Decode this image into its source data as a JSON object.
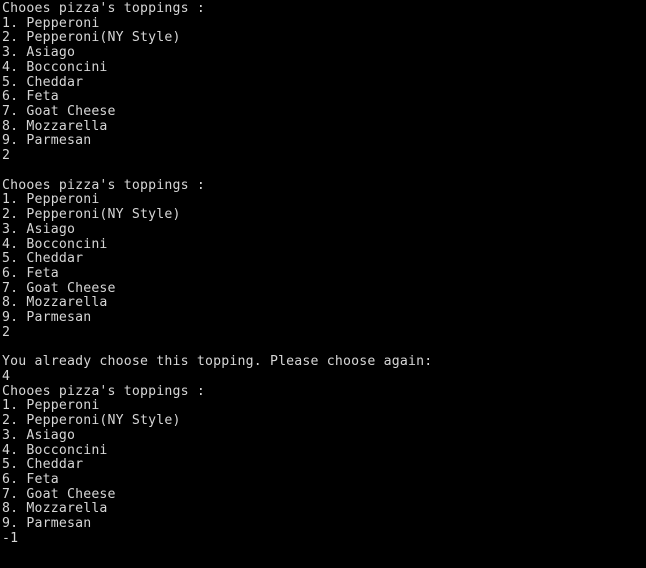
{
  "terminal": {
    "background_color": "#000000",
    "text_color": "#d6d6d6",
    "prompt_header": "Chooes pizza's toppings :",
    "warning_message": "You already choose this topping. Please choose again:",
    "menu_items": [
      "1. Pepperoni",
      "2. Pepperoni(NY Style)",
      "3. Asiago",
      "4. Bocconcini",
      "5. Cheddar",
      "6. Feta",
      "7. Goat Cheese",
      "8. Mozzarella",
      "9. Parmesan"
    ],
    "user_inputs": [
      "2",
      "2",
      "4",
      "-1"
    ],
    "lines": [
      "Chooes pizza's toppings :",
      "1. Pepperoni",
      "2. Pepperoni(NY Style)",
      "3. Asiago",
      "4. Bocconcini",
      "5. Cheddar",
      "6. Feta",
      "7. Goat Cheese",
      "8. Mozzarella",
      "9. Parmesan",
      "2",
      "",
      "Chooes pizza's toppings :",
      "1. Pepperoni",
      "2. Pepperoni(NY Style)",
      "3. Asiago",
      "4. Bocconcini",
      "5. Cheddar",
      "6. Feta",
      "7. Goat Cheese",
      "8. Mozzarella",
      "9. Parmesan",
      "2",
      "",
      "You already choose this topping. Please choose again:",
      "4",
      "Chooes pizza's toppings :",
      "1. Pepperoni",
      "2. Pepperoni(NY Style)",
      "3. Asiago",
      "4. Bocconcini",
      "5. Cheddar",
      "6. Feta",
      "7. Goat Cheese",
      "8. Mozzarella",
      "9. Parmesan",
      "-1"
    ]
  }
}
